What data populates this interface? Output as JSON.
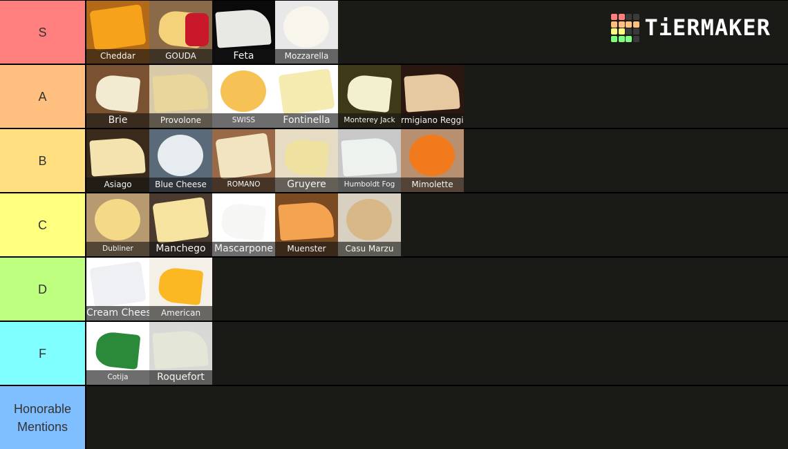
{
  "brand": {
    "name": "TiERMAKER",
    "logo_grid": [
      [
        "#ff7f7f",
        "#ff7f7f",
        "#3a3a3a",
        "#3a3a3a"
      ],
      [
        "#ffbf7f",
        "#ffbf7f",
        "#ffbf7f",
        "#ffbf7f"
      ],
      [
        "#ffff7f",
        "#ffff7f",
        "#3a3a3a",
        "#3a3a3a"
      ],
      [
        "#7fff7f",
        "#7fff7f",
        "#7fff7f",
        "#3a3a3a"
      ]
    ]
  },
  "tiers": [
    {
      "label": "S",
      "color": "#ff7f7f",
      "items": [
        {
          "name": "Cheddar",
          "icon": "cheddar-image",
          "bg": "#b26a18",
          "fg": "#f7a21b"
        },
        {
          "name": "GOUDA",
          "icon": "gouda-image",
          "bg": "#8a6a48",
          "fg": "#f3d27a",
          "accent": "#c8182a"
        },
        {
          "name": "Feta",
          "icon": "feta-image",
          "bg": "#0a0a0a",
          "fg": "#e8e8e4"
        },
        {
          "name": "Mozzarella",
          "icon": "mozzarella-image",
          "bg": "#e8e8e8",
          "fg": "#f7f5ec"
        }
      ]
    },
    {
      "label": "A",
      "color": "#ffbf7f",
      "items": [
        {
          "name": "Brie",
          "icon": "brie-image",
          "bg": "#7a5232",
          "fg": "#f3ead2"
        },
        {
          "name": "Provolone",
          "icon": "provolone-image",
          "bg": "#d8c9a8",
          "fg": "#e8d69a"
        },
        {
          "name": "SWISS",
          "icon": "swiss-image",
          "bg": "#ffffff",
          "fg": "#f7c255"
        },
        {
          "name": "Fontinella",
          "icon": "fontinella-image",
          "bg": "#ffffff",
          "fg": "#f5eab0"
        },
        {
          "name": "Monterey Jack",
          "icon": "monterey-jack-image",
          "bg": "#3e3a18",
          "fg": "#f3f0cf"
        },
        {
          "name": "Parmigiano Reggiano",
          "icon": "parmigiano-image",
          "bg": "#2a1810",
          "fg": "#e6c9a0"
        }
      ]
    },
    {
      "label": "B",
      "color": "#ffdf7f",
      "items": [
        {
          "name": "Asiago",
          "icon": "asiago-image",
          "bg": "#3a2a1c",
          "fg": "#f4e3ae"
        },
        {
          "name": "Blue Cheese",
          "icon": "blue-cheese-image",
          "bg": "#5a6a78",
          "fg": "#e6ecf0"
        },
        {
          "name": "ROMANO",
          "icon": "romano-image",
          "bg": "#9a6a48",
          "fg": "#f2e4c0"
        },
        {
          "name": "Gruyere",
          "icon": "gruyere-image",
          "bg": "#e6dcc4",
          "fg": "#efe1a0"
        },
        {
          "name": "Humboldt Fog",
          "icon": "humboldt-fog-image",
          "bg": "#c8c8c8",
          "fg": "#eef2ee"
        },
        {
          "name": "Mimolette",
          "icon": "mimolette-image",
          "bg": "#b89070",
          "fg": "#f07a1c"
        }
      ]
    },
    {
      "label": "C",
      "color": "#ffff7f",
      "items": [
        {
          "name": "Dubliner",
          "icon": "dubliner-image",
          "bg": "#b89a70",
          "fg": "#f4da88"
        },
        {
          "name": "Manchego",
          "icon": "manchego-image",
          "bg": "#4a3a30",
          "fg": "#f6e3a0"
        },
        {
          "name": "Mascarpone",
          "icon": "mascarpone-image",
          "bg": "#ffffff",
          "fg": "#f6f6f4"
        },
        {
          "name": "Muenster",
          "icon": "muenster-image",
          "bg": "#7a4a22",
          "fg": "#f4a450"
        },
        {
          "name": "Casu Marzu",
          "icon": "casu-marzu-image",
          "bg": "#d8d0c0",
          "fg": "#d8b888"
        }
      ]
    },
    {
      "label": "D",
      "color": "#bfff7f",
      "items": [
        {
          "name": "Cream Cheese",
          "icon": "cream-cheese-image",
          "bg": "#ffffff",
          "fg": "#eef0f4"
        },
        {
          "name": "American",
          "icon": "american-image",
          "bg": "#f4f0e8",
          "fg": "#fbb822"
        }
      ]
    },
    {
      "label": "F",
      "color": "#7fffff",
      "items": [
        {
          "name": "Cotija",
          "icon": "cotija-image",
          "bg": "#ffffff",
          "fg": "#2a8a3a"
        },
        {
          "name": "Roquefort",
          "icon": "roquefort-image",
          "bg": "#d8d8d6",
          "fg": "#e4e6d8"
        }
      ]
    },
    {
      "label": "Honorable\nMentions",
      "color": "#7fbfff",
      "items": []
    }
  ]
}
